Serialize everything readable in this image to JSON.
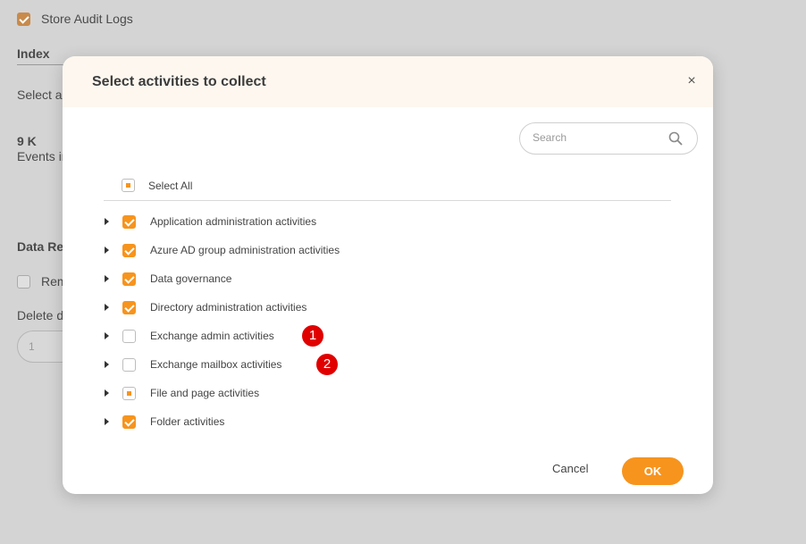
{
  "background": {
    "store_audit_logs_label": "Store Audit Logs",
    "index_heading": "Index",
    "select_link": "Select a",
    "event_count": "9 K",
    "event_count_label": "Events in",
    "data_retention_heading": "Data Re",
    "remove_label": "Rem",
    "delete_label": "Delete d",
    "delete_input_value": "1"
  },
  "modal": {
    "title": "Select activities to collect",
    "close_glyph": "×",
    "search_placeholder": "Search",
    "select_all_label": "Select All",
    "items": [
      {
        "label": "Application administration activities",
        "state": "checked"
      },
      {
        "label": "Azure AD group administration activities",
        "state": "checked"
      },
      {
        "label": "Data governance",
        "state": "checked"
      },
      {
        "label": "Directory administration activities",
        "state": "checked"
      },
      {
        "label": "Exchange admin activities",
        "state": "unchecked",
        "badge": "1"
      },
      {
        "label": "Exchange mailbox activities",
        "state": "unchecked",
        "badge": "2"
      },
      {
        "label": "File and page activities",
        "state": "partial"
      },
      {
        "label": "Folder activities",
        "state": "checked"
      }
    ],
    "cancel_label": "Cancel",
    "ok_label": "OK"
  },
  "colors": {
    "accent": "#f7941d",
    "badge": "#e00000",
    "header_bg": "#fdf7ef"
  }
}
